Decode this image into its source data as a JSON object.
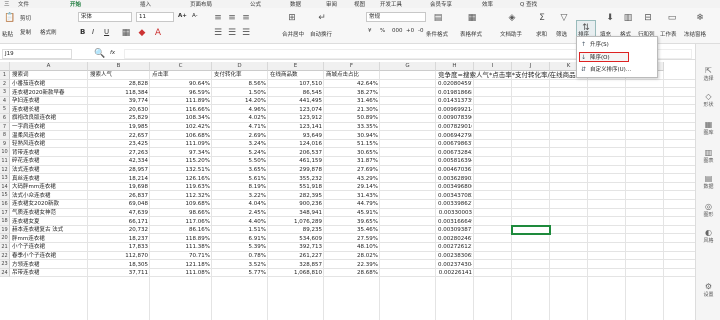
{
  "topmenu": [
    "三",
    "文件",
    "开始",
    "插入",
    "页面布局",
    "公式",
    "数据",
    "审阅",
    "视图",
    "开发工具",
    "会员专享",
    "效率",
    "Q 查找"
  ],
  "ribbon": {
    "paste": "粘贴",
    "cut": "剪切",
    "copy": "复制",
    "format_painter": "格式刷",
    "font_name": "宋体",
    "font_size": "11",
    "bold": "B",
    "italic": "I",
    "underline": "U",
    "font_grow": "A+",
    "font_shrink": "A-",
    "merge": "合并居中",
    "wrap": "自动换行",
    "number_format": "常规",
    "currency": "¥",
    "percent": "%",
    "thousands": "000",
    "dec_inc": "+0",
    "dec_dec": "-0",
    "cond_format": "条件格式",
    "table_style": "表格样式",
    "doc_assist": "文档助手",
    "sum": "求和",
    "filter": "筛选",
    "sort": "排序",
    "fill": "填充",
    "format": "格式",
    "rows_cols": "行和列",
    "worksheet": "工作表",
    "freeze": "冻结窗格"
  },
  "sort_menu": {
    "asc": "升序(S)",
    "desc": "降序(O)",
    "custom": "自定义排序(U)..."
  },
  "formula_bar": {
    "name_box": "J19",
    "fx": "fx",
    "value": ""
  },
  "columns": [
    "A",
    "B",
    "C",
    "D",
    "E",
    "F",
    "G",
    "H",
    "I",
    "J",
    "K",
    "L",
    "M"
  ],
  "headers": [
    "搜索词",
    "搜索人气",
    "点击率",
    "支付转化率",
    "在线商品数",
    "商城点击占比",
    "",
    "竞争度=搜索人气*点击率*支付转化率/在线商品数"
  ],
  "rows": [
    [
      "小番茄连衣裙",
      "28,828",
      "90.64%",
      "8.56%",
      "107,510",
      "42.64%",
      "",
      "0.020804597"
    ],
    [
      "连衣裙2020新款早春",
      "118,384",
      "96.59%",
      "1.50%",
      "86,545",
      "38.27%",
      "",
      "0.019818668"
    ],
    [
      "孕妇连衣裙",
      "39,774",
      "111.89%",
      "14.20%",
      "441,495",
      "31.46%",
      "",
      "0.014313739"
    ],
    [
      "连衣裙长裙",
      "20,630",
      "116.66%",
      "4.96%",
      "123,074",
      "21.30%",
      "",
      "0.009699214"
    ],
    [
      "旗袍改良版连衣裙",
      "25,829",
      "108.34%",
      "4.02%",
      "123,912",
      "50.89%",
      "",
      "0.009078396"
    ],
    [
      "一字肩连衣裙",
      "19,985",
      "102.42%",
      "4.71%",
      "123,141",
      "33.35%",
      "",
      "0.007829016"
    ],
    [
      "温柔风连衣裙",
      "22,657",
      "106.68%",
      "2.69%",
      "93,649",
      "30.94%",
      "",
      "0.006942798"
    ],
    [
      "轻熟风连衣裙",
      "23,425",
      "111.09%",
      "3.24%",
      "124,016",
      "51.15%",
      "",
      "0.006798637"
    ],
    [
      "背带连衣裙",
      "27,263",
      "97.34%",
      "5.24%",
      "206,537",
      "30.65%",
      "",
      "0.006732842"
    ],
    [
      "碎花连衣裙",
      "42,334",
      "115.20%",
      "5.50%",
      "461,159",
      "31.87%",
      "",
      "0.005816394"
    ],
    [
      "法式连衣裙",
      "28,957",
      "132.51%",
      "3.65%",
      "299,878",
      "27.69%",
      "",
      "0.004670361"
    ],
    [
      "真丝连衣裙",
      "18,214",
      "126.16%",
      "5.61%",
      "355,232",
      "43.29%",
      "",
      "0.003628903"
    ],
    [
      "大码胖mm连衣裙",
      "19,698",
      "119.63%",
      "8.19%",
      "551,918",
      "29.14%",
      "",
      "0.003496806"
    ],
    [
      "法式小众连衣裙",
      "26,837",
      "112.32%",
      "3.22%",
      "282,395",
      "31.43%",
      "",
      "0.003437082"
    ],
    [
      "连衣裙女2020新款",
      "69,048",
      "109.68%",
      "4.04%",
      "900,236",
      "44.79%",
      "",
      "0.003398627"
    ],
    [
      "气质连衣裙女神范",
      "47,639",
      "98.66%",
      "2.45%",
      "348,941",
      "45.91%",
      "",
      "0.00330003"
    ],
    [
      "连衣裙女夏",
      "66,171",
      "117.06%",
      "4.40%",
      "1,076,289",
      "39.65%",
      "",
      "0.003166649"
    ],
    [
      "赫本连衣裙复古 法式",
      "20,732",
      "86.16%",
      "1.51%",
      "89,235",
      "35.46%",
      "",
      "0.003093871"
    ],
    [
      "胖mm连衣裙",
      "18,237",
      "118.89%",
      "6.91%",
      "534,609",
      "27.59%",
      "",
      "0.002802467"
    ],
    [
      "小个子连衣裙",
      "17,833",
      "111.38%",
      "5.39%",
      "392,713",
      "48.10%",
      "",
      "0.002726121"
    ],
    [
      "春季小个子连衣裙",
      "112,870",
      "70.71%",
      "0.78%",
      "261,227",
      "28.02%",
      "",
      "0.002383065"
    ],
    [
      "方领连衣裙",
      "18,305",
      "121.18%",
      "3.52%",
      "328,857",
      "22.39%",
      "",
      "0.002374304"
    ],
    [
      "吊带连衣裙",
      "37,711",
      "111.08%",
      "5.77%",
      "1,068,810",
      "28.68%",
      "",
      "0.00226141"
    ]
  ],
  "sidebar": [
    "选择",
    "形状",
    "图库",
    "图表",
    "数据",
    "图形",
    "风格",
    "设置"
  ],
  "colors": {
    "accent": "#1e8a3c",
    "highlight": "#dd2222"
  }
}
